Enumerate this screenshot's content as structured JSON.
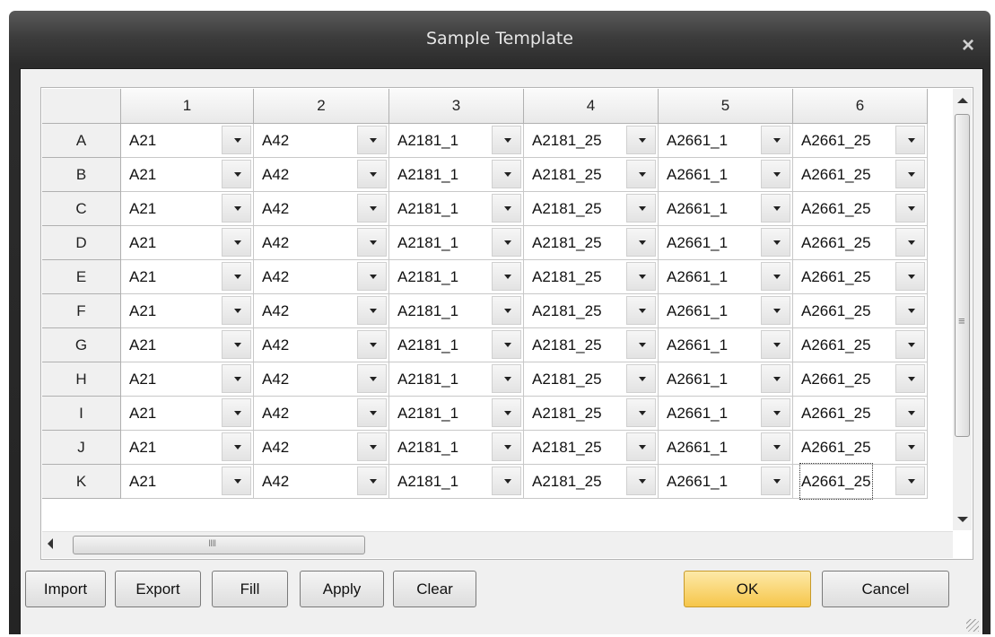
{
  "window": {
    "title": "Sample Template"
  },
  "grid": {
    "columns": [
      "1",
      "2",
      "3",
      "4",
      "5",
      "6"
    ],
    "rows": [
      "A",
      "B",
      "C",
      "D",
      "E",
      "F",
      "G",
      "H",
      "I",
      "J",
      "K"
    ],
    "column_values": [
      "A21",
      "A42",
      "A2181_1",
      "A2181_25",
      "A2661_1",
      "A2661_25"
    ],
    "focused_cell": {
      "row": "K",
      "column": "6"
    }
  },
  "buttons": {
    "import": "Import",
    "export": "Export",
    "fill": "Fill",
    "apply": "Apply",
    "clear": "Clear",
    "ok": "OK",
    "cancel": "Cancel"
  },
  "icons": [
    "close-icon",
    "dropdown-arrow-icon",
    "scroll-up-icon",
    "scroll-down-icon",
    "scroll-left-icon",
    "resize-grip-icon"
  ]
}
